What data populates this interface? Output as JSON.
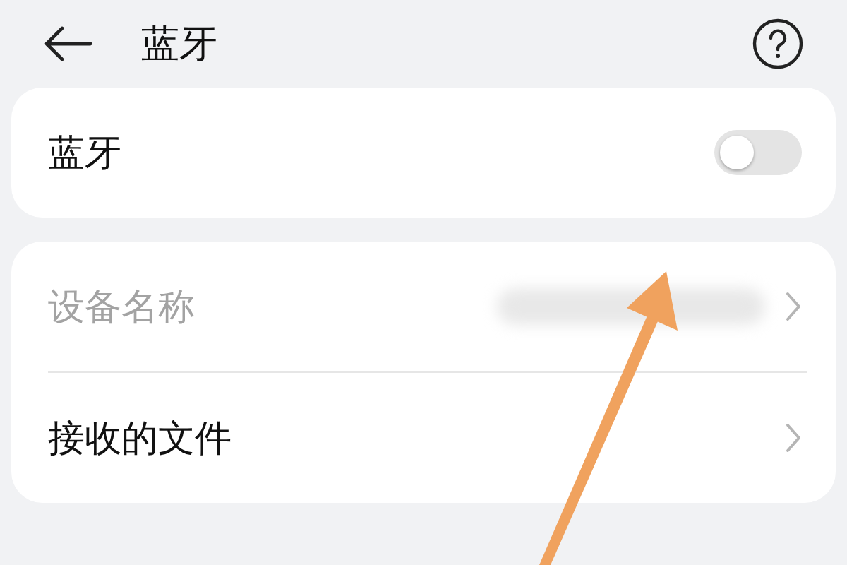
{
  "header": {
    "title": "蓝牙"
  },
  "toggle_row": {
    "label": "蓝牙",
    "on": false
  },
  "items": [
    {
      "label": "设备名称",
      "disabled": true,
      "value_hidden": true
    },
    {
      "label": "接收的文件",
      "disabled": false,
      "value_hidden": false
    }
  ]
}
